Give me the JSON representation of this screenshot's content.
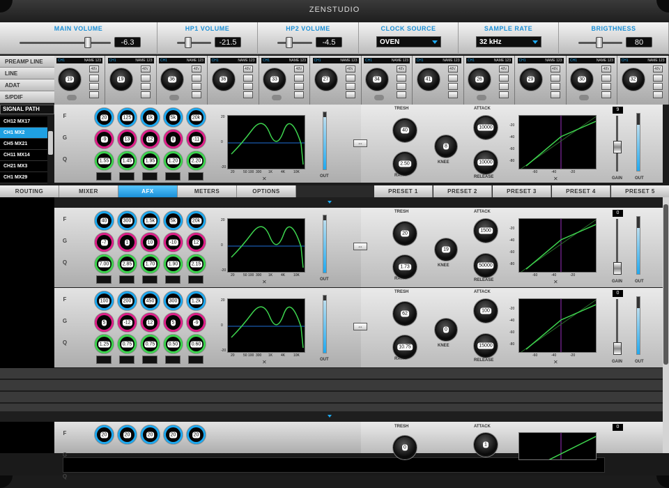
{
  "app": {
    "title": "ZENSTUDIO"
  },
  "topbar": [
    {
      "label": "MAIN VOLUME",
      "value": "-6.3",
      "kind": "slider"
    },
    {
      "label": "HP1 VOLUME",
      "value": "-21.5",
      "kind": "slider"
    },
    {
      "label": "HP2 VOLUME",
      "value": "-4.5",
      "kind": "slider"
    },
    {
      "label": "CLOCK SOURCE",
      "value": "OVEN",
      "kind": "dropdown"
    },
    {
      "label": "SAMPLE RATE",
      "value": "32 kHz",
      "kind": "dropdown"
    },
    {
      "label": "BRIGTHNESS",
      "value": "80",
      "kind": "slider"
    }
  ],
  "nav": {
    "items": [
      "PREAMP LINE",
      "LINE",
      "ADAT",
      "S/PDIF"
    ],
    "signal_path": "SIGNAL PATH",
    "channels": [
      "CH12 MX17",
      "CH1 MX2",
      "CH5 MX21",
      "CH11 MX14",
      "CH21 MX3",
      "CH1 MX29"
    ],
    "selected": 1
  },
  "channels": [
    {
      "ch": "CH1",
      "name": "NAME 123",
      "gain": "19",
      "b48v": "48V"
    },
    {
      "ch": "CH1",
      "name": "NAME 123",
      "gain": "19",
      "b48v": "48V"
    },
    {
      "ch": "CH1",
      "name": "NAME 123",
      "gain": "36",
      "b48v": "48V"
    },
    {
      "ch": "CH1",
      "name": "NAME 123",
      "gain": "36",
      "b48v": "48V"
    },
    {
      "ch": "CH1",
      "name": "NAME 123",
      "gain": "33",
      "b48v": "48V"
    },
    {
      "ch": "CH1",
      "name": "NAME 123",
      "gain": "27",
      "b48v": "48V"
    },
    {
      "ch": "CH1",
      "name": "NAME 123",
      "gain": "34",
      "b48v": "48V"
    },
    {
      "ch": "CH1",
      "name": "NAME 123",
      "gain": "41",
      "b48v": "48V"
    },
    {
      "ch": "CH1",
      "name": "NAME 123",
      "gain": "26",
      "b48v": "48V"
    },
    {
      "ch": "CH1",
      "name": "NAME 123",
      "gain": "29",
      "b48v": "48V"
    },
    {
      "ch": "CH1",
      "name": "NAME 123",
      "gain": "30",
      "b48v": "48V"
    },
    {
      "ch": "CH1",
      "name": "NAME 123",
      "gain": "32",
      "b48v": "48V"
    }
  ],
  "labels": {
    "f": "F",
    "g": "G",
    "q": "Q",
    "tresh": "TRESH",
    "ratio": "RATIO",
    "knee": "KNEE",
    "attack": "ATTACK",
    "release": "RELEASE",
    "gain": "GAIN",
    "out": "OUT",
    "eq_x": [
      "20",
      "50 100",
      "300",
      "1K",
      "4K",
      "10K"
    ],
    "eq_y": [
      "20",
      "0",
      "-20"
    ],
    "comp_y": [
      "-20",
      "-40",
      "-60",
      "-80"
    ],
    "comp_x": [
      "-60",
      "-40",
      "-20"
    ]
  },
  "strips": [
    {
      "f": [
        "20",
        "125",
        "1k",
        "5k",
        "20k"
      ],
      "g": [
        "-9",
        "13",
        "12",
        "8",
        "-11"
      ],
      "q": [
        "1.55",
        "1.45",
        "1.95",
        "1.20",
        "2.20"
      ],
      "tresh": "40",
      "ratio": "2.50",
      "knee": "8",
      "attack": "10000",
      "release": "10000",
      "gain": "9"
    },
    {
      "f": [
        "40",
        "300",
        "1.5k",
        "5k",
        "20k"
      ],
      "g": [
        "-7",
        "1",
        "10",
        "-10",
        "12"
      ],
      "q": [
        "7.00",
        "2.85",
        "1.70",
        "1.90",
        "2.15"
      ],
      "tresh": "20",
      "ratio": "1.73",
      "knee": "19",
      "attack": "1500",
      "release": "50000",
      "gain": "0"
    },
    {
      "f": [
        "100",
        "200",
        "450",
        "300",
        "1.2k"
      ],
      "g": [
        "5",
        "-12",
        "12",
        "5",
        "-9"
      ],
      "q": [
        "1.25",
        "0.75",
        "0.75",
        "0.50",
        "0.60"
      ],
      "tresh": "62",
      "ratio": "10.75",
      "knee": "0",
      "attack": "100",
      "release": "15000",
      "gain": "0"
    },
    {
      "f": [
        "20",
        "20",
        "20",
        "20",
        "20"
      ],
      "tresh": "0",
      "attack": "1",
      "gain": "0"
    }
  ],
  "tabs": [
    "ROUTING",
    "MIXER",
    "AFX",
    "METERS",
    "OPTIONS"
  ],
  "active_tab": "AFX",
  "presets": [
    "PRESET 1",
    "PRESET 2",
    "PRESET 3",
    "PRESET 4",
    "PRESET 5"
  ],
  "colors": {
    "accent": "#1ea9f0",
    "pink": "#e0218a",
    "green": "#3dd44e"
  }
}
